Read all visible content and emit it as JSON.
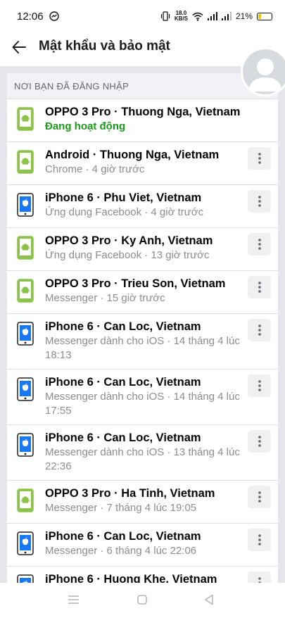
{
  "status_bar": {
    "time": "12:06",
    "net_speed_value": "18.0",
    "net_speed_unit": "KB/S",
    "battery": "21%"
  },
  "header": {
    "title": "Mật khẩu và bảo mật"
  },
  "section": {
    "title": "NƠI BẠN ĐÃ ĐĂNG NHẬP"
  },
  "sessions": [
    {
      "device": "OPPO 3 Pro · Thuong Nga, Vietnam",
      "detail": "Đang hoạt động",
      "icon": "android-phone-icon",
      "active": true
    },
    {
      "device": "Android · Thuong Nga, Vietnam",
      "detail": "Chrome · 4 giờ trước",
      "icon": "android-phone-icon"
    },
    {
      "device": "iPhone 6 · Phu Viet, Vietnam",
      "detail": "Ứng dụng Facebook · 4 giờ trước",
      "icon": "iphone-icon"
    },
    {
      "device": "OPPO 3 Pro · Ky Anh, Vietnam",
      "detail": "Ứng dụng Facebook · 13 giờ trước",
      "icon": "android-phone-icon"
    },
    {
      "device": "OPPO 3 Pro · Trieu Son, Vietnam",
      "detail": "Messenger · 15 giờ trước",
      "icon": "android-phone-icon"
    },
    {
      "device": "iPhone 6 · Can Loc, Vietnam",
      "detail": "Messenger dành cho iOS · 14 tháng 4 lúc 18:13",
      "icon": "iphone-icon"
    },
    {
      "device": "iPhone 6 · Can Loc, Vietnam",
      "detail": "Messenger dành cho iOS · 14 tháng 4 lúc 17:55",
      "icon": "iphone-icon"
    },
    {
      "device": "iPhone 6 · Can Loc, Vietnam",
      "detail": "Messenger dành cho iOS · 13 tháng 4 lúc 22:36",
      "icon": "iphone-icon"
    },
    {
      "device": "OPPO 3 Pro · Ha Tinh, Vietnam",
      "detail": "Messenger · 7 tháng 4 lúc 19:05",
      "icon": "android-phone-icon"
    },
    {
      "device": "iPhone 6 · Can Loc, Vietnam",
      "detail": "Messenger · 6 tháng 4 lúc 22:06",
      "icon": "iphone-icon"
    },
    {
      "device": "iPhone 6 · Huong Khe, Vietnam",
      "detail": "",
      "icon": "iphone-icon"
    }
  ],
  "colors": {
    "android_green": "#8bc34a",
    "iphone_blue": "#1877f2",
    "active_green": "#1a9b1a"
  }
}
